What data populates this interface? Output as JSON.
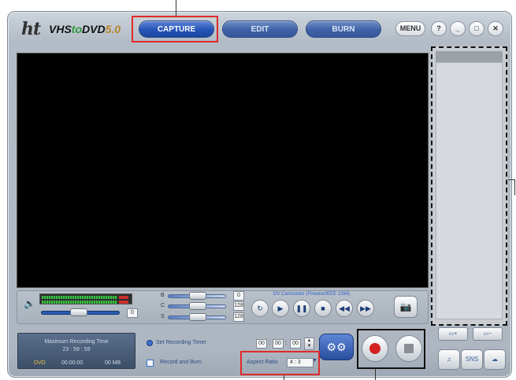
{
  "app": {
    "logo": {
      "prefix": "ht",
      "name_a": "VHS",
      "name_to": "to",
      "name_b": "DVD",
      "version": "5.0"
    },
    "tabs": [
      {
        "label": "CAPTURE",
        "active": true
      },
      {
        "label": "EDIT",
        "active": false
      },
      {
        "label": "BURN",
        "active": false
      }
    ],
    "window_controls": {
      "menu": "MENU",
      "help": "?",
      "minimize": "_",
      "maximize": "□",
      "close": "✕"
    }
  },
  "audio": {
    "mute_icon": "speaker-icon",
    "volume_value": "0"
  },
  "adjust": {
    "rows": [
      {
        "label": "B",
        "value": "0"
      },
      {
        "label": "C",
        "value": "128"
      },
      {
        "label": "S",
        "value": "128"
      }
    ]
  },
  "device": {
    "label": "DV Camcorder (Firewire/IEEE 1394)"
  },
  "transport": [
    "↻",
    "▶",
    "❚❚",
    "■",
    "◀◀",
    "▶▶"
  ],
  "recording_time": {
    "title": "Maximum Recording Time",
    "time": "23 : 59 : 59",
    "format": "DVD",
    "elapsed": "00:00:00",
    "size": "00 MB"
  },
  "options": {
    "set_timer": "Set Recording Timer",
    "record_burn": "Record and Burn",
    "timer": [
      "00",
      "00",
      "00"
    ],
    "aspect_label": "Aspect Ratio",
    "aspect_value": "4 : 3"
  },
  "right_panel": {
    "buttons": [
      "▭+",
      "▭−"
    ],
    "icons": [
      "♫",
      "SNS",
      "☁"
    ]
  },
  "colors": {
    "accent": "#2554b8",
    "record": "#d42020",
    "highlight": "#e02a2a"
  }
}
